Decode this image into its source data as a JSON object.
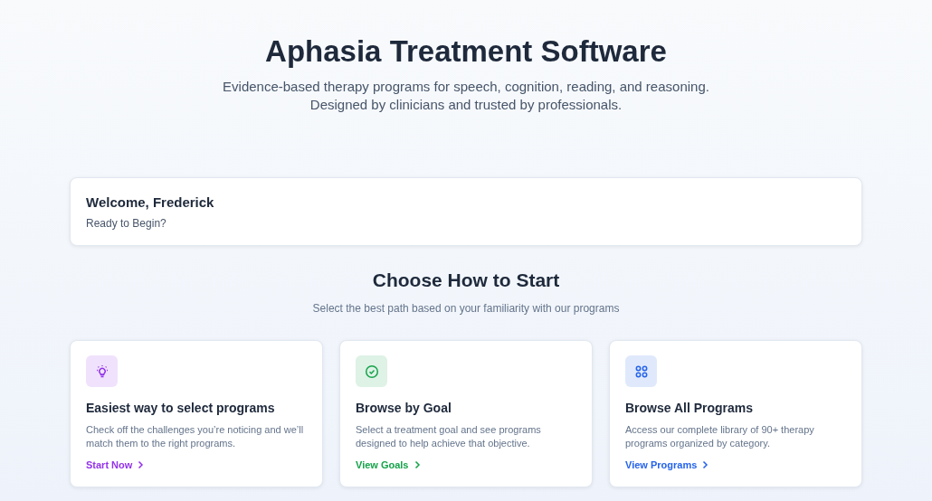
{
  "header": {
    "title": "Aphasia Treatment Software",
    "subtitle_lines": [
      "Evidence-based therapy programs for speech, cognition, reading, and reasoning.",
      "Designed by clinicians and trusted by professionals."
    ]
  },
  "welcome": {
    "title": "Welcome, Frederick",
    "subtitle": "Ready to Begin?"
  },
  "section": {
    "title": "Choose How to Start",
    "subtitle": "Select the best path based on your familiarity with our programs"
  },
  "cards": [
    {
      "kind": "bulb",
      "color": "#9333ea",
      "title": "Easiest way to select programs",
      "description": "Check off the challenges you’re noticing and we’ll match them to the right programs.",
      "link": "Start Now"
    },
    {
      "kind": "check",
      "color": "#16a34a",
      "title": "Browse by Goal",
      "description": "Select a treatment goal and see programs designed to help achieve that objective.",
      "link": "View Goals"
    },
    {
      "kind": "grid",
      "color": "#2563eb",
      "title": "Browse All Programs",
      "description": "Access our complete library of 90+ therapy programs organized by category.",
      "link": "View Programs"
    }
  ]
}
